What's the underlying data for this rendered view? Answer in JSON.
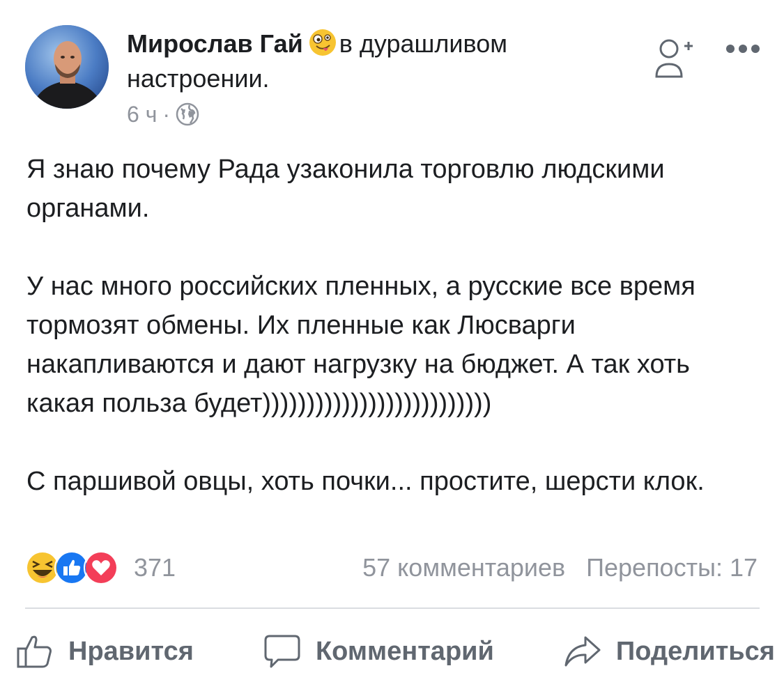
{
  "post": {
    "author": "Мирослав Гай",
    "feeling": "в дурашливом настроении.",
    "time": "6 ч",
    "separator": "·",
    "paragraphs": [
      "Я знаю почему Рада узаконила торговлю людскими органами.",
      "У нас много российских пленных, а русские все время тормозят обмены. Их пленные как Люсварги накапливаются и дают нагрузку на бюджет. А так хоть какая польза будет))))))))))))))))))))))))))",
      "С паршивой овцы, хоть почки... простите, шерсти клок."
    ],
    "icons": {
      "feeling": "goofy-face-emoji",
      "privacy": "globe-icon",
      "add_friend": "add-friend-icon",
      "more": "more-icon"
    }
  },
  "reactions": {
    "count": "371",
    "types": [
      "haha",
      "like",
      "love"
    ],
    "colors": {
      "haha": "#f7b928",
      "like": "#1877f2",
      "love": "#f33e58"
    }
  },
  "stats": {
    "comments": "57 комментариев",
    "shares": "Перепосты: 17"
  },
  "actions": {
    "like": "Нравится",
    "comment": "Комментарий",
    "share": "Поделиться"
  }
}
